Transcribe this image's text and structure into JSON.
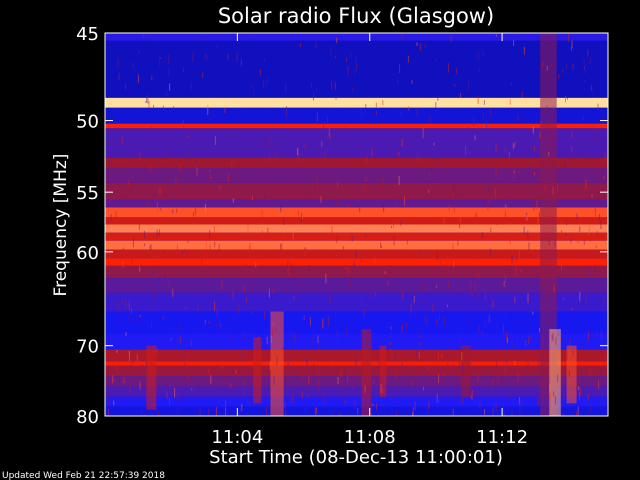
{
  "chart_data": {
    "type": "heatmap",
    "title": "Solar radio Flux (Glasgow)",
    "xlabel": "Start Time (08-Dec-13 11:00:01)",
    "ylabel": "Frequency [MHz]",
    "footer": "Updated Wed Feb 21 22:57:39 2018",
    "x_axis": {
      "unit": "minutes after 11:00:01",
      "range": [
        0,
        15.2
      ],
      "ticks": [
        {
          "value": 4,
          "label": "11:04"
        },
        {
          "value": 8,
          "label": "11:08"
        },
        {
          "value": 12,
          "label": "11:12"
        }
      ]
    },
    "y_axis": {
      "unit": "MHz",
      "scale": "reciprocal",
      "range": [
        45,
        80
      ],
      "inverted": true,
      "ticks": [
        {
          "value": 45,
          "label": "45"
        },
        {
          "value": 50,
          "label": "50"
        },
        {
          "value": 55,
          "label": "55"
        },
        {
          "value": 60,
          "label": "60"
        },
        {
          "value": 70,
          "label": "70"
        },
        {
          "value": 80,
          "label": "80"
        }
      ]
    },
    "colormap": [
      "#000060",
      "#1a1aff",
      "#5a1a9a",
      "#a01830",
      "#ff2000",
      "#ffe0a0"
    ],
    "frequency_bands": [
      {
        "from": 45,
        "to": 45.4,
        "level": 0.25
      },
      {
        "from": 45.4,
        "to": 48.6,
        "level": 0.12
      },
      {
        "from": 48.6,
        "to": 49.2,
        "level": 1.0
      },
      {
        "from": 49.2,
        "to": 50.2,
        "level": 0.15
      },
      {
        "from": 50.2,
        "to": 50.5,
        "level": 0.8
      },
      {
        "from": 50.5,
        "to": 52.5,
        "level": 0.35
      },
      {
        "from": 52.5,
        "to": 53.2,
        "level": 0.6
      },
      {
        "from": 53.2,
        "to": 54.3,
        "level": 0.45
      },
      {
        "from": 54.3,
        "to": 55.6,
        "level": 0.55
      },
      {
        "from": 55.6,
        "to": 56.2,
        "level": 0.42
      },
      {
        "from": 56.2,
        "to": 57.0,
        "level": 0.85
      },
      {
        "from": 57.0,
        "to": 57.6,
        "level": 0.7
      },
      {
        "from": 57.6,
        "to": 58.3,
        "level": 0.9
      },
      {
        "from": 58.3,
        "to": 59.0,
        "level": 0.72
      },
      {
        "from": 59.0,
        "to": 59.8,
        "level": 0.88
      },
      {
        "from": 59.8,
        "to": 60.6,
        "level": 0.68
      },
      {
        "from": 60.6,
        "to": 61.3,
        "level": 0.8
      },
      {
        "from": 61.3,
        "to": 62.5,
        "level": 0.55
      },
      {
        "from": 62.5,
        "to": 64.0,
        "level": 0.4
      },
      {
        "from": 64.0,
        "to": 66.0,
        "level": 0.3
      },
      {
        "from": 66.0,
        "to": 68.5,
        "level": 0.18
      },
      {
        "from": 68.5,
        "to": 70.5,
        "level": 0.22
      },
      {
        "from": 70.5,
        "to": 72.0,
        "level": 0.62
      },
      {
        "from": 72.0,
        "to": 72.6,
        "level": 0.78
      },
      {
        "from": 72.6,
        "to": 74.0,
        "level": 0.58
      },
      {
        "from": 74.0,
        "to": 75.5,
        "level": 0.45
      },
      {
        "from": 75.5,
        "to": 77.0,
        "level": 0.35
      },
      {
        "from": 77.0,
        "to": 78.5,
        "level": 0.22
      },
      {
        "from": 78.5,
        "to": 80,
        "level": 0.16
      }
    ],
    "bursts": [
      {
        "time": 5.2,
        "width": 0.4,
        "from": 66,
        "to": 80,
        "level": 0.85
      },
      {
        "time": 4.6,
        "width": 0.25,
        "from": 69,
        "to": 78,
        "level": 0.7
      },
      {
        "time": 7.9,
        "width": 0.3,
        "from": 68,
        "to": 80,
        "level": 0.65
      },
      {
        "time": 8.4,
        "width": 0.2,
        "from": 70,
        "to": 77,
        "level": 0.7
      },
      {
        "time": 1.4,
        "width": 0.3,
        "from": 70,
        "to": 79,
        "level": 0.7
      },
      {
        "time": 13.4,
        "width": 0.5,
        "from": 45,
        "to": 80,
        "level": 0.55
      },
      {
        "time": 13.6,
        "width": 0.35,
        "from": 68,
        "to": 80,
        "level": 0.95
      },
      {
        "time": 14.1,
        "width": 0.3,
        "from": 70,
        "to": 78,
        "level": 0.85
      },
      {
        "time": 10.9,
        "width": 0.3,
        "from": 70,
        "to": 77,
        "level": 0.6
      }
    ]
  }
}
